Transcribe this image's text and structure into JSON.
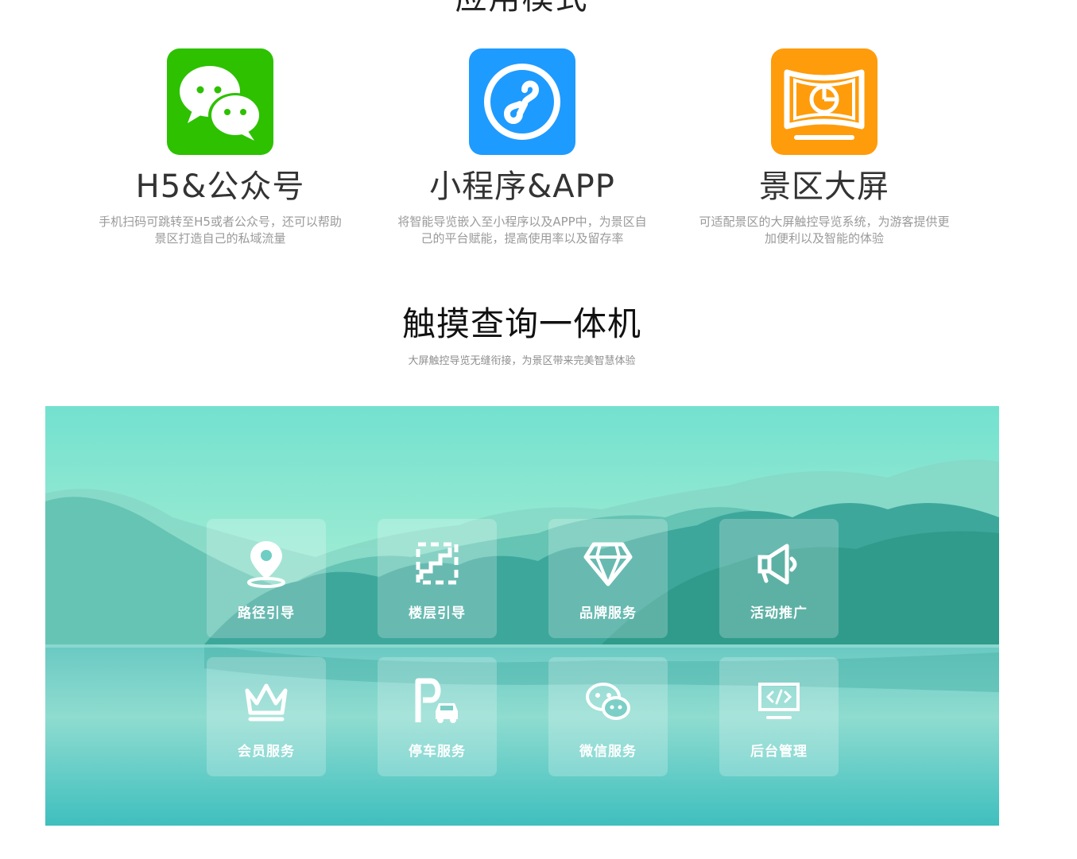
{
  "section_top": {
    "title": "应用模式"
  },
  "modes": [
    {
      "title": "H5&公众号",
      "desc": "手机扫码可跳转至H5或者公众号，还可以帮助景区打造自己的私域流量",
      "icon": "wechat-icon",
      "color": "#2dc100"
    },
    {
      "title": "小程序&APP",
      "desc": "将智能导览嵌入至小程序以及APP中，为景区自己的平台赋能，提高使用率以及留存率",
      "icon": "mini-program-icon",
      "color": "#1e9bff"
    },
    {
      "title": "景区大屏",
      "desc": "可适配景区的大屏触控导览系统，为游客提供更加便利以及智能的体验",
      "icon": "big-screen-icon",
      "color": "#ff9c0b"
    }
  ],
  "kiosk": {
    "title": "触摸查询一体机",
    "subtitle": "大屏触控导览无缝衔接，为景区带来完美智慧体验"
  },
  "features": [
    {
      "label": "路径引导",
      "icon": "location-pin-icon"
    },
    {
      "label": "楼层引导",
      "icon": "stairs-icon"
    },
    {
      "label": "品牌服务",
      "icon": "diamond-icon"
    },
    {
      "label": "活动推广",
      "icon": "megaphone-icon"
    },
    {
      "label": "会员服务",
      "icon": "crown-icon"
    },
    {
      "label": "停车服务",
      "icon": "parking-car-icon"
    },
    {
      "label": "微信服务",
      "icon": "wechat-icon"
    },
    {
      "label": "后台管理",
      "icon": "code-monitor-icon"
    }
  ]
}
